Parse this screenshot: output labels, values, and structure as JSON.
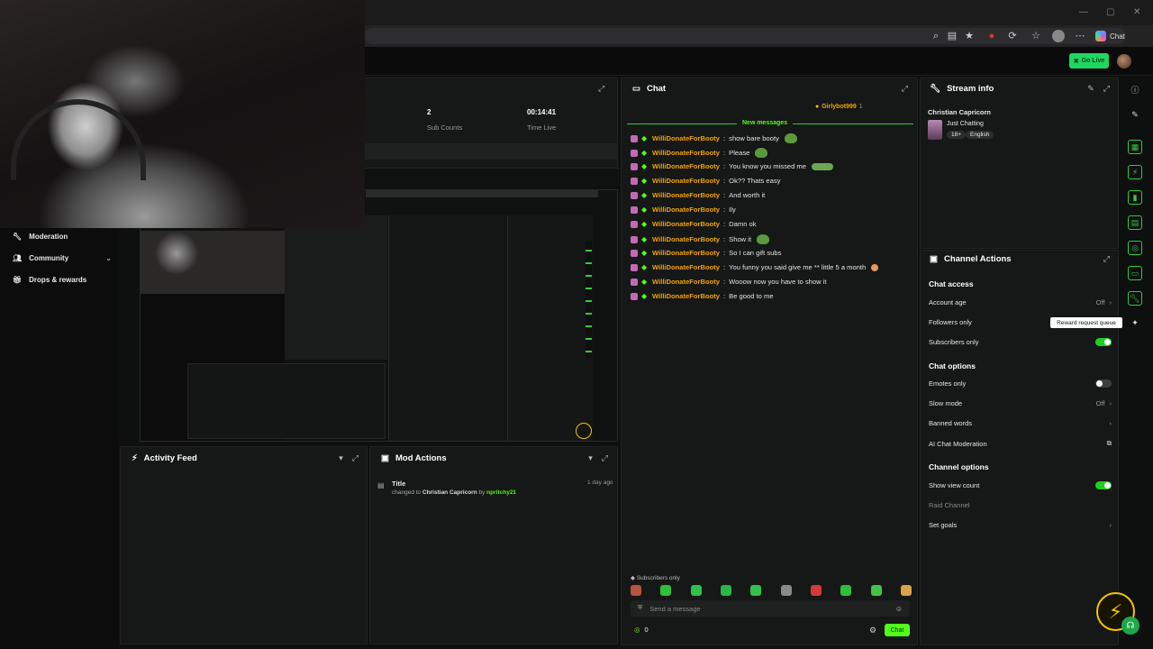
{
  "browser": {
    "chat_label": "Chat",
    "window_controls": [
      "—",
      "▢",
      "✕"
    ]
  },
  "appbar": {
    "go_live_label": "Go Live"
  },
  "nav": {
    "items": [
      {
        "label": "Moderation",
        "icon": "wrench-icon"
      },
      {
        "label": "Community",
        "icon": "people-icon",
        "expandable": true
      },
      {
        "label": "Drops & rewards",
        "icon": "gift-icon"
      }
    ]
  },
  "stats": [
    {
      "value": "2",
      "label": "Sub Counts"
    },
    {
      "value": "00:14:41",
      "label": "Time Live"
    }
  ],
  "activity_feed": {
    "title": "Activity Feed"
  },
  "mod_actions": {
    "title": "Mod Actions",
    "entry": {
      "title": "Title",
      "pre": "changed to",
      "new_title": "Christian Capricorn",
      "by": "by",
      "user": "npritchy21",
      "time": "1 day ago"
    }
  },
  "chat": {
    "title": "Chat",
    "pinned_user": "Girlybot999",
    "pinned_count": "1",
    "new_messages_label": "New messages",
    "messages": [
      {
        "user": "WilliDonateForBooty",
        "text": "show bare booty",
        "emote": "pepe"
      },
      {
        "user": "WilliDonateForBooty",
        "text": "Please",
        "emote": "pepe"
      },
      {
        "user": "WilliDonateForBooty",
        "text": "You know you missed me",
        "emote": "frog"
      },
      {
        "user": "WilliDonateForBooty",
        "text": "Ok?? Thats easy",
        "emote": ""
      },
      {
        "user": "WilliDonateForBooty",
        "text": "And worth it",
        "emote": ""
      },
      {
        "user": "WilliDonateForBooty",
        "text": "Ily",
        "emote": ""
      },
      {
        "user": "WilliDonateForBooty",
        "text": "Damn ok",
        "emote": ""
      },
      {
        "user": "WilliDonateForBooty",
        "text": "Show it",
        "emote": "pepe"
      },
      {
        "user": "WilliDonateForBooty",
        "text": "So I can gift subs",
        "emote": ""
      },
      {
        "user": "WilliDonateForBooty",
        "text": "You funny you said give me ** little 5 a month",
        "emote": "face"
      },
      {
        "user": "WilliDonateForBooty",
        "text": "Wooow now you have to show it",
        "emote": ""
      },
      {
        "user": "WilliDonateForBooty",
        "text": "Be good to me",
        "emote": ""
      }
    ],
    "subscribers_only_label": "Subscribers only",
    "input_placeholder": "Send a message",
    "points": "0",
    "send_label": "Chat",
    "emote_colors": [
      "#b4553c",
      "#2fbf3b",
      "#31c24a",
      "#28b84a",
      "#33c04f",
      "#8a8a8a",
      "#d33b3b",
      "#2fbf3b",
      "#41c548",
      "#d8a24a"
    ]
  },
  "stream_info": {
    "title": "Stream info",
    "stream_title": "Christian Capricorn",
    "category": "Just Chatting",
    "tags": [
      "18+",
      "English"
    ]
  },
  "channel_actions": {
    "title": "Channel Actions",
    "chat_access_heading": "Chat access",
    "account_age_label": "Account age",
    "account_age_value": "Off",
    "followers_only_label": "Followers only",
    "subscribers_only_label": "Subscribers only",
    "chat_options_heading": "Chat options",
    "emotes_only_label": "Emotes only",
    "slow_mode_label": "Slow mode",
    "slow_mode_value": "Off",
    "banned_words_label": "Banned words",
    "ai_moderation_label": "AI Chat Moderation",
    "channel_options_heading": "Channel options",
    "show_view_count_label": "Show view count",
    "raid_channel_label": "Raid Channel",
    "set_goals_label": "Set goals"
  },
  "tooltip": "Reward request queue",
  "colors": {
    "accent": "#53fc18",
    "username": "#f0a400",
    "bolt": "#f5c400"
  }
}
